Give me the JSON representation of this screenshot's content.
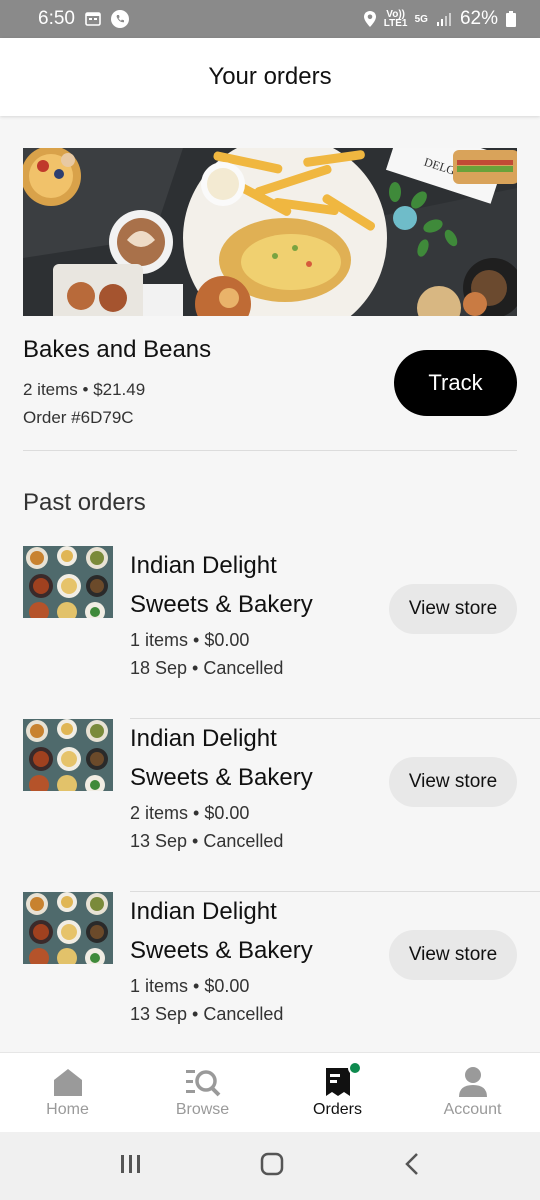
{
  "status_bar": {
    "time": "6:50",
    "network": "Vo)) LTE1",
    "signal_5g": "5G",
    "battery": "62%"
  },
  "header": {
    "title": "Your orders"
  },
  "current_order": {
    "store_name": "Bakes and Beans",
    "summary": "2 items • $21.49",
    "order_number": "Order #6D79C",
    "track_label": "Track",
    "hero_sign": "DELGANI"
  },
  "past_orders": {
    "title": "Past orders",
    "items": [
      {
        "name_line1": "Indian Delight",
        "name_line2": "Sweets & Bakery",
        "summary": "1 items • $0.00",
        "status": "18 Sep • Cancelled",
        "button": "View store"
      },
      {
        "name_line1": "Indian Delight",
        "name_line2": "Sweets & Bakery",
        "summary": "2 items • $0.00",
        "status": "13 Sep • Cancelled",
        "button": "View store"
      },
      {
        "name_line1": "Indian Delight",
        "name_line2": "Sweets & Bakery",
        "summary": "1 items • $0.00",
        "status": "13 Sep • Cancelled",
        "button": "View store"
      }
    ]
  },
  "bottom_nav": {
    "items": [
      {
        "label": "Home",
        "icon": "home-icon"
      },
      {
        "label": "Browse",
        "icon": "browse-icon"
      },
      {
        "label": "Orders",
        "icon": "orders-icon",
        "active": true
      },
      {
        "label": "Account",
        "icon": "account-icon"
      }
    ]
  },
  "colors": {
    "accent_black": "#000000",
    "badge_green": "#0e8a4f",
    "muted": "#9a9a9a"
  }
}
